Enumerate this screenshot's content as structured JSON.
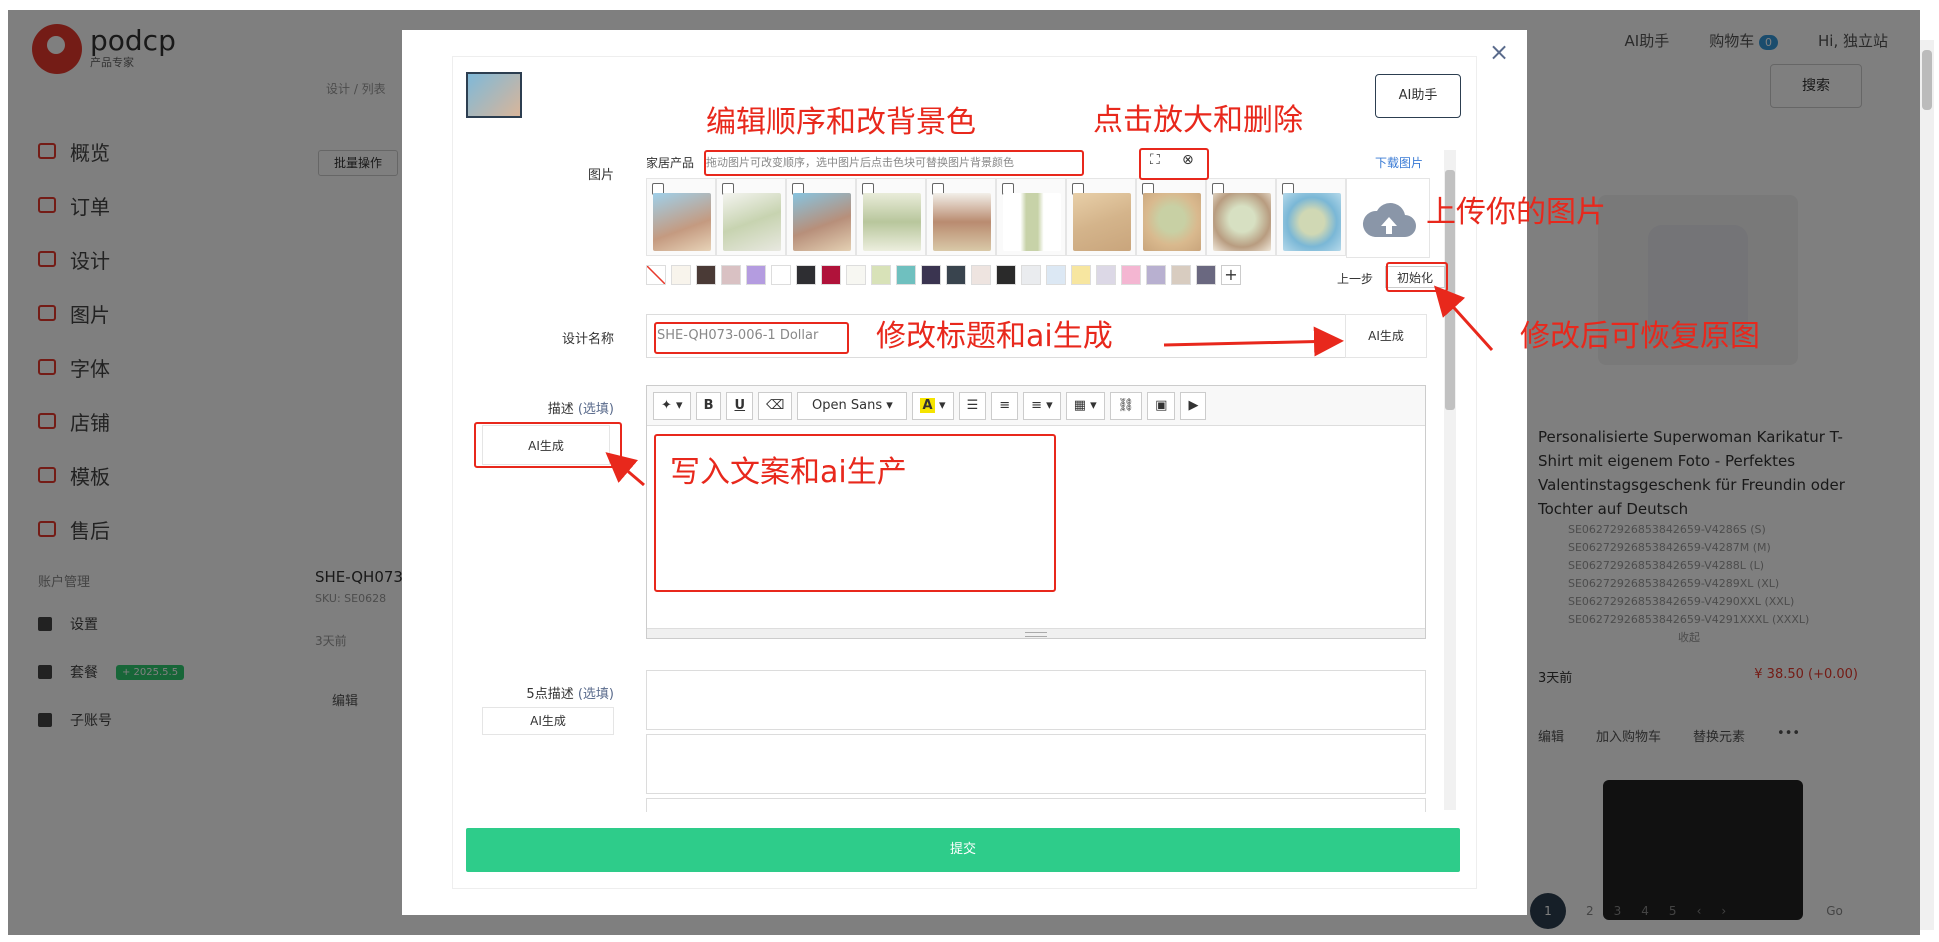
{
  "background": {
    "logo": {
      "name": "podcp",
      "tagline": "产品专家"
    },
    "nav": [
      "概览",
      "订单",
      "设计",
      "图片",
      "字体",
      "店铺",
      "模板",
      "售后"
    ],
    "nav_section": "账户管理",
    "nav_small": [
      {
        "label": "设置",
        "badge": ""
      },
      {
        "label": "套餐",
        "badge": "+ 2025.5.5"
      },
      {
        "label": "子账号",
        "badge": ""
      }
    ],
    "top": {
      "ai_label": "AI助手",
      "cart": "购物车",
      "cart_count": "0",
      "user": "Hi, 独立站"
    },
    "search_label": "搜索",
    "crumb": "设计 / 列表",
    "batch": "批量操作",
    "left_card": {
      "title": "SHE-QH073-",
      "sku": "SKU: SE0628",
      "days": "3天前",
      "edit": "编辑"
    },
    "right_card": {
      "title": "Personalisierte Superwoman Karikatur T-Shirt mit eigenem Foto - Perfektes Valentinstagsgeschenk für Freundin oder Tochter auf Deutsch",
      "skus": [
        "SE06272926853842659-V4286S (S)",
        "SE06272926853842659-V4287M (M)",
        "SE06272926853842659-V4288L (L)",
        "SE06272926853842659-V4289XL (XL)",
        "SE06272926853842659-V4290XXL (XXL)",
        "SE06272926853842659-V4291XXXL (XXXL)"
      ],
      "collapse": "收起",
      "days": "3天前",
      "price": "¥ 38.50 (+0.00)",
      "actions": [
        "编辑",
        "加入购物车",
        "替换元素",
        "•••"
      ]
    },
    "pager": [
      "1",
      "2",
      "3",
      "4",
      "5",
      "‹",
      "›",
      "Go"
    ]
  },
  "modal": {
    "close": "×",
    "ai_helper": "AI助手",
    "images": {
      "label": "图片",
      "product_type": "家居产品",
      "hint": "拖动图片可改变顺序，选中图片后点击色块可替换图片背景颜色",
      "download": "下载图片",
      "prev_step": "上一步",
      "reset": "初始化",
      "count": 10
    },
    "swatch_colors": [
      "#f8f4ec",
      "#4a3a36",
      "#d9c1c3",
      "#b49ce0",
      "#ffffff",
      "#2e2e32",
      "#b0123a",
      "#f7f7f2",
      "#d8e2b8",
      "#6fc0bf",
      "#3a3450",
      "#39444e",
      "#eee4e0",
      "#2a2a2a",
      "#eaecef",
      "#dce8f4",
      "#f7e6a0",
      "#dcd8e6",
      "#f4b6d2",
      "#b8b0d0",
      "#d8ccc0",
      "#6a6880"
    ],
    "design_name": {
      "label": "设计名称",
      "value": "SHE-QH073-006-1 Dollar",
      "ai": "AI生成"
    },
    "description": {
      "label": "描述",
      "optional": "(选填)",
      "ai": "AI生成"
    },
    "toolbar": {
      "font": "Open Sans",
      "bold": "B",
      "underline": "U"
    },
    "five_point": {
      "label": "5点描述",
      "optional": "(选填)",
      "ai": "AI生成"
    },
    "submit": "提交"
  },
  "annotations": {
    "edit_order": "编辑顺序和改背景色",
    "zoom_delete": "点击放大和删除",
    "upload": "上传你的图片",
    "restore": "修改后可恢复原图",
    "title_ai": "修改标题和ai生成",
    "write_copy": "写入文案和ai生产"
  },
  "colors": {
    "accent_red": "#e8281c",
    "submit_green": "#2ecc8a",
    "brand_red": "#e8392c"
  }
}
